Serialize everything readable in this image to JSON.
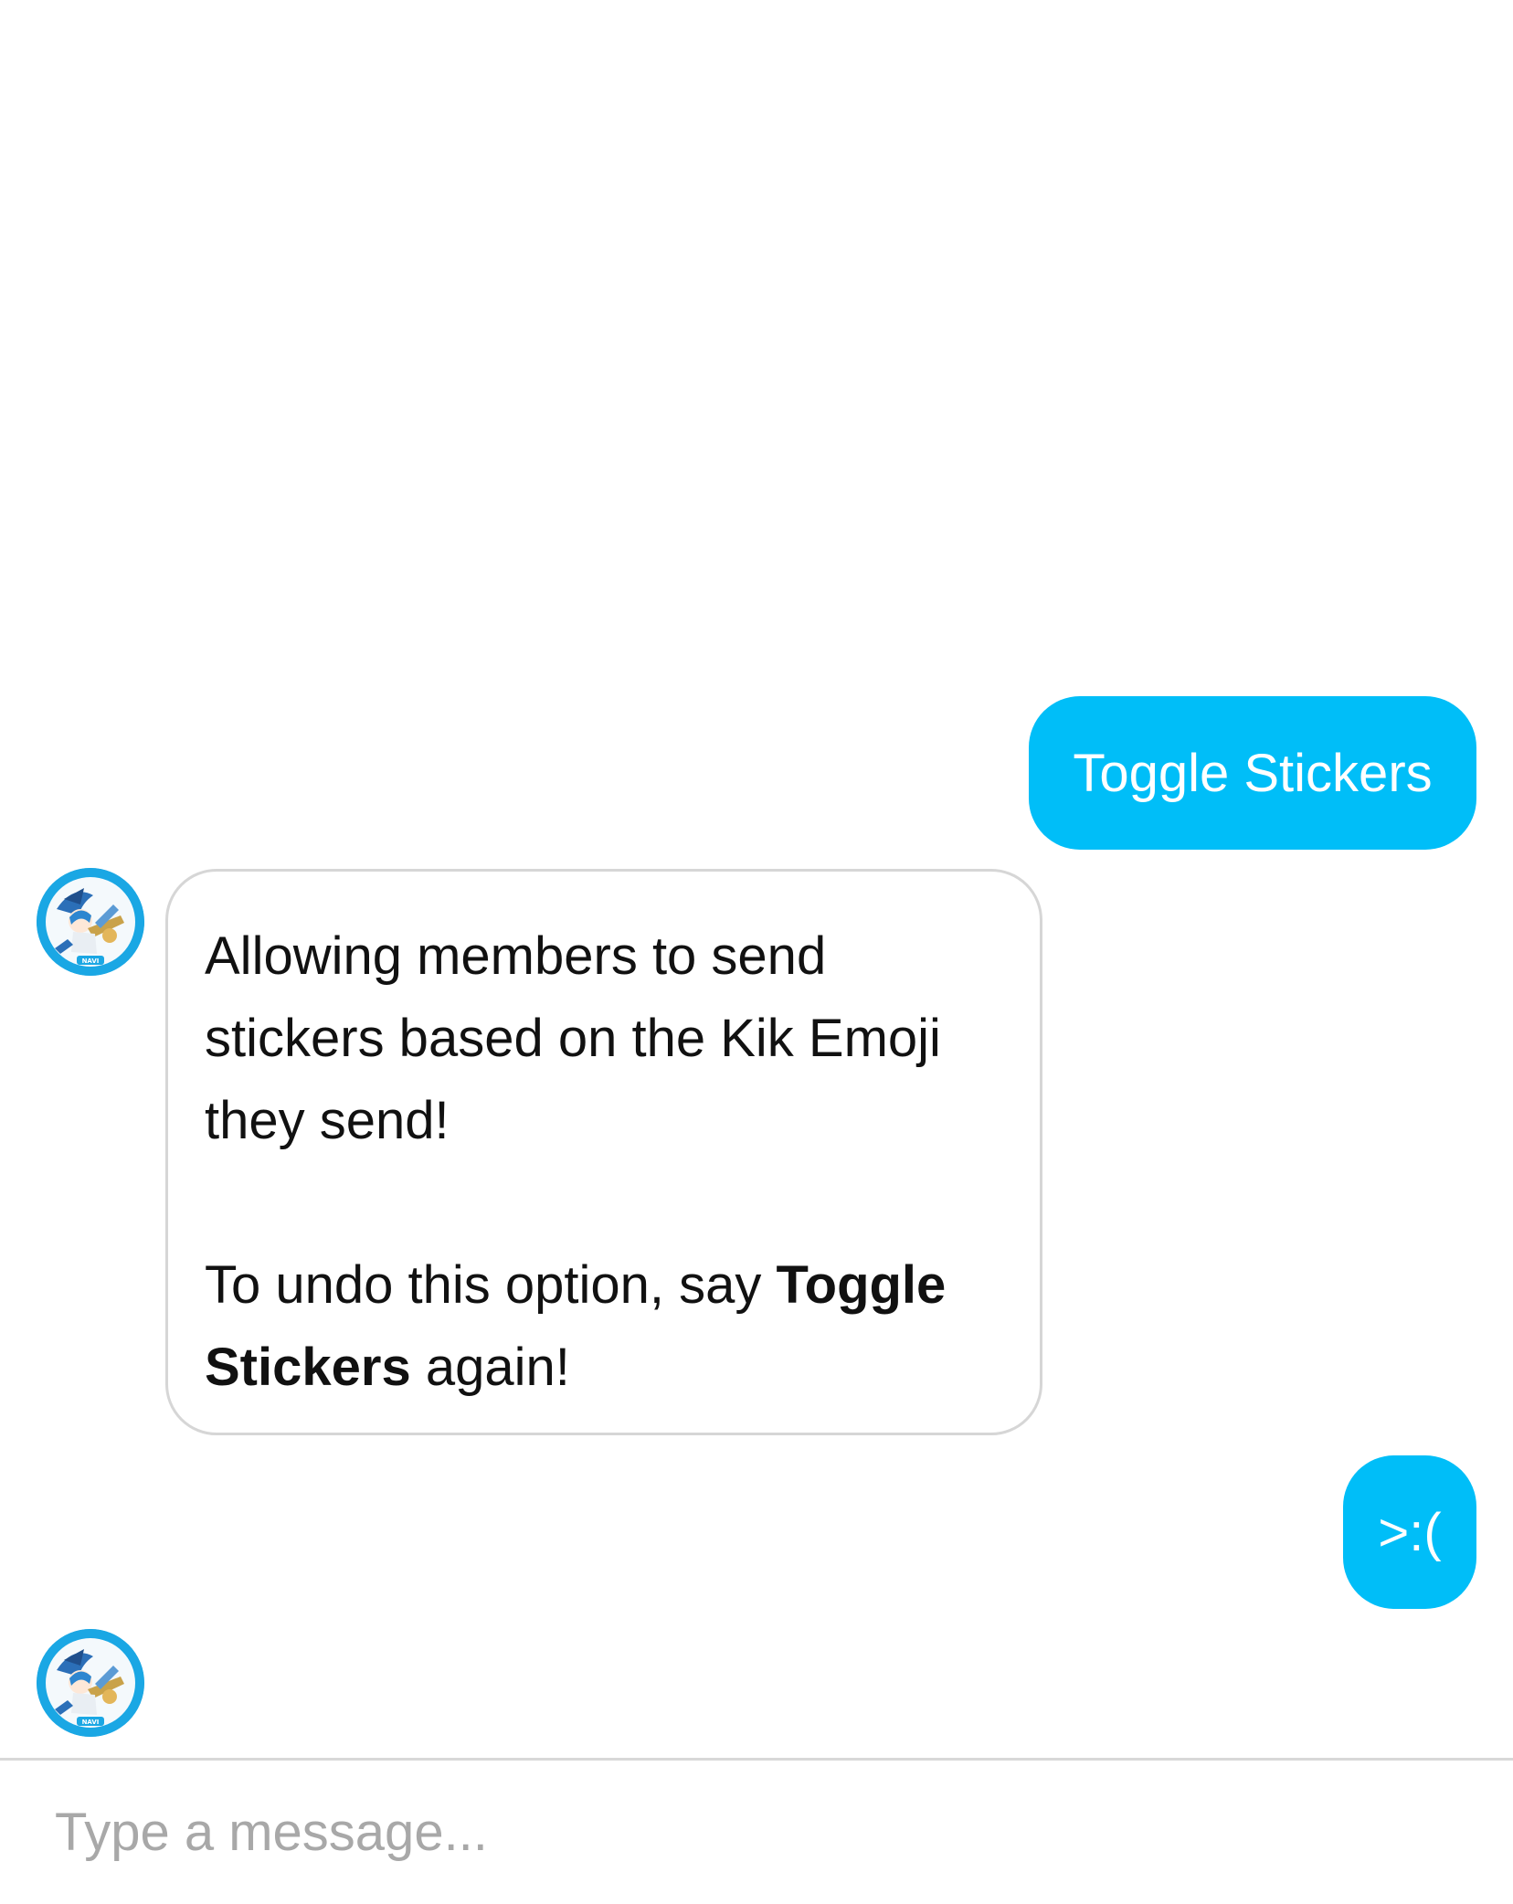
{
  "chat": {
    "messages": [
      {
        "from": "me",
        "text": "Toggle Stickers"
      },
      {
        "from": "bot",
        "paragraph1": "Allowing members to send stickers based on the Kik Emoji they send!",
        "paragraph2_before": "To undo this option, say ",
        "paragraph2_bold": "Toggle Stickers",
        "paragraph2_after": " again!"
      },
      {
        "from": "me",
        "text": ">:("
      }
    ],
    "avatar_badge": "NAVI"
  },
  "composer": {
    "placeholder": "Type a message...",
    "value": ""
  },
  "colors": {
    "outgoing_bubble": "#00bef8",
    "incoming_border": "#d6d6d6",
    "avatar_ring": "#1aa7e4"
  }
}
